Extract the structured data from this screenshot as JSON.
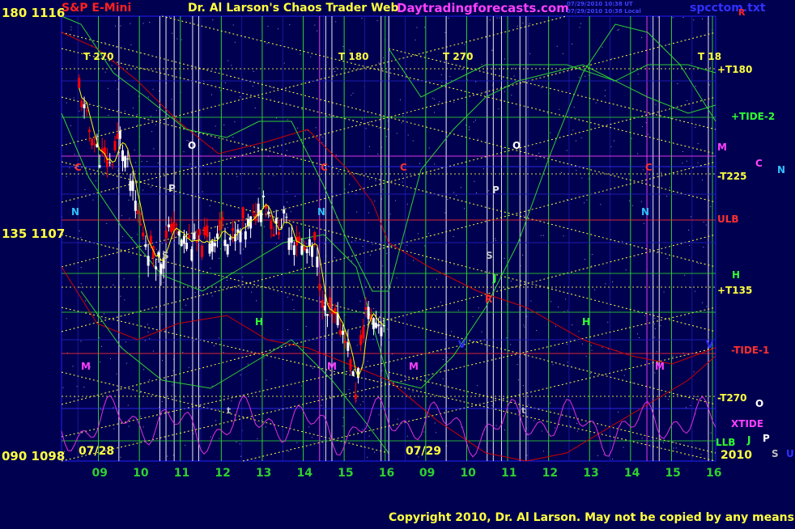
{
  "header": {
    "instrument": "S&P E-Mini",
    "main_title": "Dr. Al Larson's Chaos Trader Web",
    "site": "Daytradingforecasts.com",
    "stamp_line1": "07/29/2010 10:38 UT",
    "stamp_line2": "07/29/2010 10:38 Local",
    "filename": "spcctom.txt",
    "corner_R": "R"
  },
  "footer": {
    "copyright": "Copyright 2010, Dr. Al Larson. May not be copied by any means.",
    "year": "2010"
  },
  "price_axis": [
    {
      "angle": "180",
      "price": "1116"
    },
    {
      "angle": "135",
      "price": "1107"
    },
    {
      "angle": "090",
      "price": "1098"
    }
  ],
  "dates": [
    "07/28",
    "07/29"
  ],
  "time_markers": [
    {
      "label": "T 270"
    },
    {
      "label": "T 180"
    },
    {
      "label": "T 270"
    },
    {
      "label": "T 18"
    }
  ],
  "right_labels": {
    "t180p": "+T180",
    "tide2": "+TIDE-2",
    "m": "M",
    "c": "C",
    "n": "N",
    "t225m": "-T225",
    "ulb": "ULB",
    "h": "H",
    "t135p": "+T135",
    "tide1": "-TIDE-1",
    "t270m": "-T270",
    "o": "O",
    "xtide": "XTIDE",
    "llb": "LLB",
    "j": "J",
    "p": "P",
    "s": "S",
    "u": "U"
  },
  "planet_labels": {
    "o": "O",
    "p": "P",
    "c": "C",
    "n": "N",
    "s": "S",
    "h": "H",
    "m": "M",
    "v": "V",
    "t": "t",
    "j": "J",
    "r": "R"
  },
  "colors": {
    "background": "#000050",
    "grid_green": "#2fd02f",
    "grid_blue": "#2020ff",
    "yellow_dotted": "#ffff40",
    "candle_up": "#ffffff",
    "candle_down": "#ff0000",
    "tide_green": "#30d030",
    "tide_red": "#d00000",
    "xtide_magenta": "#e030e0",
    "ma_yellow": "#ffff00"
  },
  "chart_data": {
    "type": "line",
    "title": "S&P E-Mini",
    "y_ticks": [
      {
        "label": "180 1116",
        "value": 1116
      },
      {
        "label": "135 1107",
        "value": 1107
      },
      {
        "label": "090 1098",
        "value": 1098
      }
    ],
    "ylim": [
      1098,
      1116
    ],
    "x_ticks": [
      "09",
      "10",
      "11",
      "12",
      "13",
      "14",
      "15",
      "16",
      "09",
      "10",
      "11",
      "12",
      "13",
      "14",
      "15",
      "16"
    ],
    "dates": [
      "07/28",
      "07/29"
    ],
    "series": [
      {
        "name": "S&P E-Mini",
        "x": [
          8.5,
          8.75,
          9.0,
          9.25,
          9.5,
          9.75,
          10.0,
          10.25,
          10.5,
          10.75,
          11.0,
          11.25,
          11.5,
          11.75,
          12.0,
          12.25,
          12.5,
          12.75,
          13.0,
          13.25,
          13.5,
          13.75,
          14.0,
          14.25,
          14.5,
          14.75,
          15.0,
          15.25,
          15.5,
          15.75,
          16.0
        ],
        "values": [
          1112.8,
          1111.2,
          1110.2,
          1109.8,
          1111.0,
          1109.2,
          1107.3,
          1106.3,
          1106.0,
          1107.4,
          1106.8,
          1106.7,
          1106.5,
          1106.9,
          1107.3,
          1106.8,
          1107.2,
          1107.6,
          1108.7,
          1107.2,
          1107.6,
          1106.9,
          1106.3,
          1106.5,
          1103.8,
          1103.5,
          1103.0,
          1100.6,
          1103.9,
          1103.5,
          1103.5
        ]
      }
    ]
  }
}
